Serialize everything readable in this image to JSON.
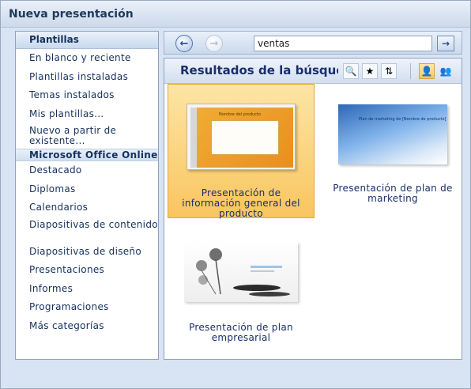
{
  "window": {
    "title": "Nueva presentación"
  },
  "sidebar": {
    "header": "Plantillas",
    "items": [
      {
        "label": "En blanco y reciente",
        "kind": "single"
      },
      {
        "label": "Plantillas instaladas",
        "kind": "single"
      },
      {
        "label": "Temas instalados",
        "kind": "single"
      },
      {
        "label": "Mis plantillas...",
        "kind": "single"
      },
      {
        "label": "Nuevo a partir de existente...",
        "kind": "double"
      },
      {
        "label": "Microsoft Office Online",
        "kind": "section"
      },
      {
        "label": "Destacado",
        "kind": "single"
      },
      {
        "label": "Diplomas",
        "kind": "single"
      },
      {
        "label": "Calendarios",
        "kind": "single"
      },
      {
        "label": "Diapositivas de contenido",
        "kind": "double"
      },
      {
        "label": "Diapositivas de diseño",
        "kind": "single"
      },
      {
        "label": "Presentaciones",
        "kind": "single"
      },
      {
        "label": "Informes",
        "kind": "single"
      },
      {
        "label": "Programaciones",
        "kind": "single"
      },
      {
        "label": "Más categorías",
        "kind": "single"
      }
    ]
  },
  "search": {
    "value": "ventas"
  },
  "results": {
    "title": "Resultados de la búsqueda",
    "cards": [
      {
        "caption": "Presentación de información general del producto",
        "selected": true,
        "thumb_title": "Nombre del producto"
      },
      {
        "caption": "Presentación de plan de marketing",
        "selected": false,
        "thumb_title": "Plan de marketing de [Nombre de producto]"
      },
      {
        "caption": "Presentación de plan empresarial",
        "selected": false
      }
    ]
  },
  "colors": {
    "accent": "#f9c55f",
    "text": "#1a2f6b",
    "frame": "#d8e4f3"
  }
}
